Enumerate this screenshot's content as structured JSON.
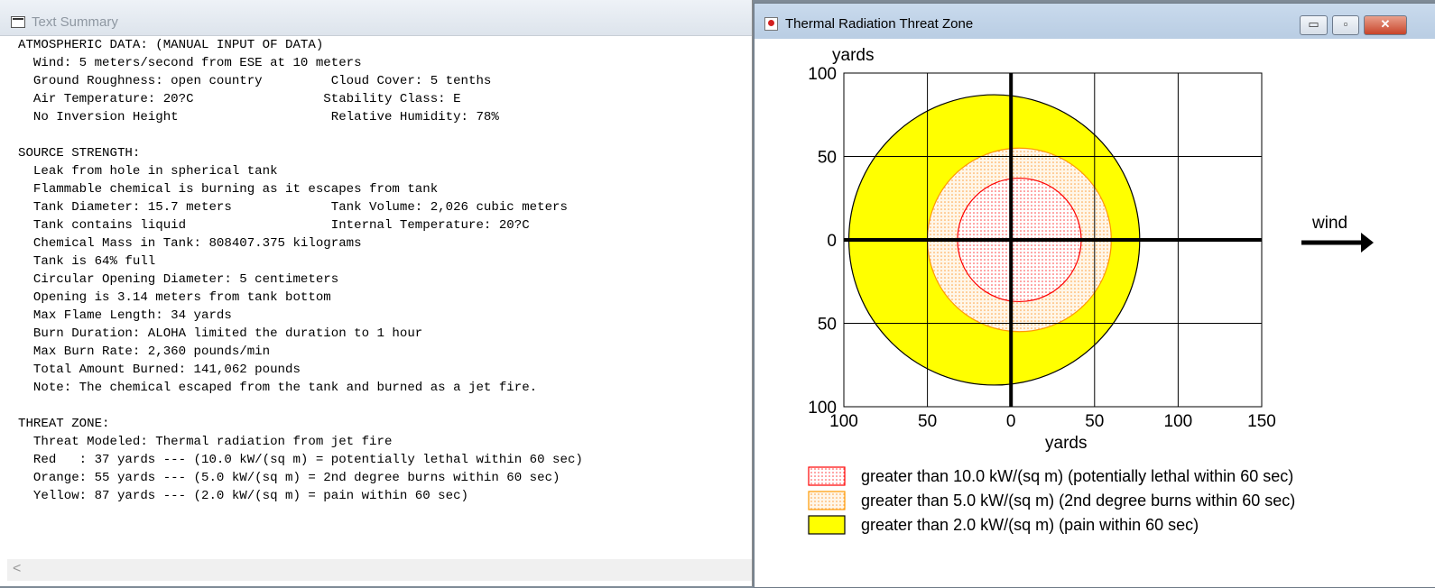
{
  "text_window": {
    "title": "Text Summary",
    "lines": [
      "ATMOSPHERIC DATA: (MANUAL INPUT OF DATA)",
      "  Wind: 5 meters/second from ESE at 10 meters",
      "  Ground Roughness: open country         Cloud Cover: 5 tenths",
      "  Air Temperature: 20?C                 Stability Class: E",
      "  No Inversion Height                    Relative Humidity: 78%",
      "",
      "SOURCE STRENGTH:",
      "  Leak from hole in spherical tank",
      "  Flammable chemical is burning as it escapes from tank",
      "  Tank Diameter: 15.7 meters             Tank Volume: 2,026 cubic meters",
      "  Tank contains liquid                   Internal Temperature: 20?C",
      "  Chemical Mass in Tank: 808407.375 kilograms",
      "  Tank is 64% full",
      "  Circular Opening Diameter: 5 centimeters",
      "  Opening is 3.14 meters from tank bottom",
      "  Max Flame Length: 34 yards",
      "  Burn Duration: ALOHA limited the duration to 1 hour",
      "  Max Burn Rate: 2,360 pounds/min",
      "  Total Amount Burned: 141,062 pounds",
      "  Note: The chemical escaped from the tank and burned as a jet fire.",
      "",
      "THREAT ZONE:",
      "  Threat Modeled: Thermal radiation from jet fire",
      "  Red   : 37 yards --- (10.0 kW/(sq m) = potentially lethal within 60 sec)",
      "  Orange: 55 yards --- (5.0 kW/(sq m) = 2nd degree burns within 60 sec)",
      "  Yellow: 87 yards --- (2.0 kW/(sq m) = pain within 60 sec)"
    ],
    "scroll_left_arrow": "<"
  },
  "threat_window": {
    "title": "Thermal Radiation Threat Zone",
    "controls": {
      "minimize": "▭",
      "maximize": "▫",
      "close": "✕"
    }
  },
  "chart_data": {
    "type": "map",
    "ylabel": "yards",
    "xlabel": "yards",
    "x_ticks": [
      "100",
      "50",
      "0",
      "50",
      "100",
      "150"
    ],
    "y_ticks": [
      "100",
      "50",
      "0",
      "50",
      "100"
    ],
    "xlim": [
      -100,
      150
    ],
    "ylim": [
      -100,
      100
    ],
    "wind_label": "wind",
    "zones": [
      {
        "name": "Yellow",
        "radius": 87,
        "center": [
          -10,
          0
        ],
        "fill": "#ffff00",
        "stroke": "#000000",
        "pattern": "solid"
      },
      {
        "name": "Orange",
        "radius": 55,
        "center": [
          5,
          0
        ],
        "fill": "#fde3c4",
        "stroke": "#ff9900",
        "pattern": "dots"
      },
      {
        "name": "Red",
        "radius": 37,
        "center": [
          5,
          0
        ],
        "fill": "#fce7ea",
        "stroke": "#ff0000",
        "pattern": "dots"
      }
    ],
    "legend": [
      {
        "label": "greater than 10.0 kW/(sq m) (potentially lethal within 60 sec)",
        "color": "#ff0000",
        "pattern": "dots"
      },
      {
        "label": "greater than 5.0 kW/(sq m) (2nd degree burns within 60 sec)",
        "color": "#ff9900",
        "pattern": "dots"
      },
      {
        "label": "greater than 2.0 kW/(sq m) (pain within 60 sec)",
        "color": "#ffff00",
        "pattern": "solid"
      }
    ]
  }
}
